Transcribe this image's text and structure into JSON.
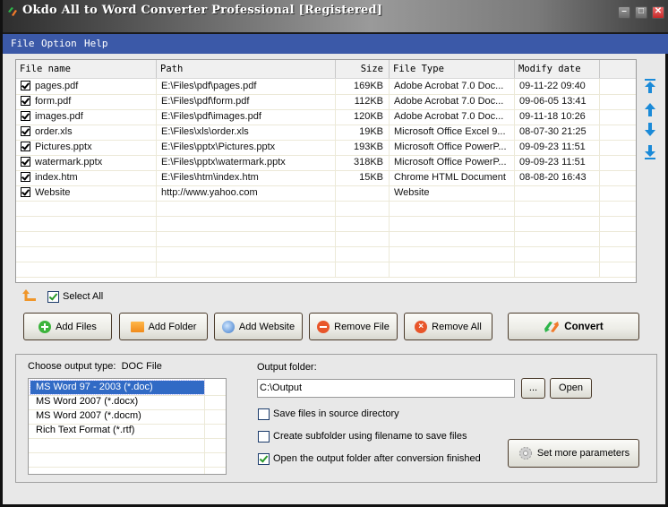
{
  "window": {
    "title": "Okdo All to Word Converter Professional [Registered]"
  },
  "menu": [
    "File",
    "Option",
    "Help"
  ],
  "file_table": {
    "columns": [
      "File name",
      "Path",
      "Size",
      "File Type",
      "Modify date"
    ],
    "rows": [
      {
        "checked": true,
        "name": "pages.pdf",
        "path": "E:\\Files\\pdf\\pages.pdf",
        "size": "169KB",
        "type": "Adobe Acrobat 7.0 Doc...",
        "date": "09-11-22 09:40"
      },
      {
        "checked": true,
        "name": "form.pdf",
        "path": "E:\\Files\\pdf\\form.pdf",
        "size": "112KB",
        "type": "Adobe Acrobat 7.0 Doc...",
        "date": "09-06-05 13:41"
      },
      {
        "checked": true,
        "name": "images.pdf",
        "path": "E:\\Files\\pdf\\images.pdf",
        "size": "120KB",
        "type": "Adobe Acrobat 7.0 Doc...",
        "date": "09-11-18 10:26"
      },
      {
        "checked": true,
        "name": "order.xls",
        "path": "E:\\Files\\xls\\order.xls",
        "size": "19KB",
        "type": "Microsoft Office Excel 9...",
        "date": "08-07-30 21:25"
      },
      {
        "checked": true,
        "name": "Pictures.pptx",
        "path": "E:\\Files\\pptx\\Pictures.pptx",
        "size": "193KB",
        "type": "Microsoft Office PowerP...",
        "date": "09-09-23 11:51"
      },
      {
        "checked": true,
        "name": "watermark.pptx",
        "path": "E:\\Files\\pptx\\watermark.pptx",
        "size": "318KB",
        "type": "Microsoft Office PowerP...",
        "date": "09-09-23 11:51"
      },
      {
        "checked": true,
        "name": "index.htm",
        "path": "E:\\Files\\htm\\index.htm",
        "size": "15KB",
        "type": "Chrome HTML Document",
        "date": "08-08-20 16:43"
      },
      {
        "checked": true,
        "name": "Website",
        "path": "http://www.yahoo.com",
        "size": "",
        "type": "Website",
        "date": ""
      }
    ]
  },
  "move_buttons": [
    "move-top",
    "move-up",
    "move-down",
    "move-bottom"
  ],
  "select_all": {
    "label": "Select All",
    "checked": true
  },
  "actions": {
    "add_files": "Add Files",
    "add_folder": "Add Folder",
    "add_website": "Add Website",
    "remove_file": "Remove File",
    "remove_all": "Remove All",
    "convert": "Convert"
  },
  "output_type": {
    "label": "Choose output type:",
    "value": "DOC File",
    "options": [
      "MS Word 97 - 2003 (*.doc)",
      "MS Word 2007 (*.docx)",
      "MS Word 2007 (*.docm)",
      "Rich Text Format (*.rtf)"
    ],
    "selected_index": 0
  },
  "output_folder": {
    "label": "Output folder:",
    "value": "C:\\Output",
    "browse_label": "...",
    "open_label": "Open"
  },
  "options": [
    {
      "label": "Save files in source directory",
      "checked": false
    },
    {
      "label": "Create subfolder using filename to save files",
      "checked": false
    },
    {
      "label": "Open the output folder after conversion finished",
      "checked": true
    }
  ],
  "more_params_label": "Set more parameters",
  "colors": {
    "menubar": "#3b59a8",
    "selection": "#316ac5",
    "accent_arrow": "#1a8ad8"
  }
}
